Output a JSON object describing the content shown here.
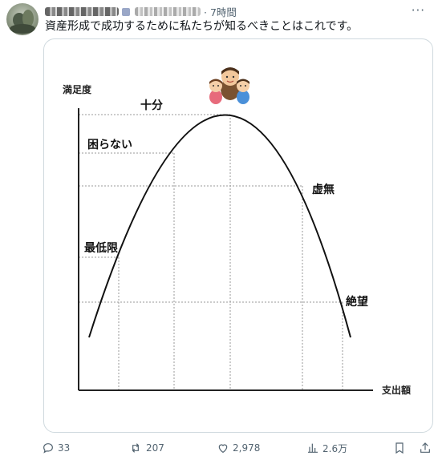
{
  "header": {
    "time": "7時間",
    "more": "···"
  },
  "tweet": {
    "text": "資産形成で成功するために私たちが知るべきことはこれです。"
  },
  "chart": {
    "y_axis_label": "満足度",
    "x_axis_label": "支出額",
    "labels": {
      "enough": "十分",
      "not_trouble": "困らない",
      "minimum": "最低限",
      "emptiness": "虚無",
      "despair": "絶望"
    }
  },
  "actions": {
    "replies": "33",
    "reposts": "207",
    "likes": "2,978",
    "views": "2.6万"
  },
  "icons": [
    "reply-icon",
    "repost-icon",
    "like-icon",
    "views-icon",
    "bookmark-icon",
    "share-icon",
    "more-icon"
  ]
}
